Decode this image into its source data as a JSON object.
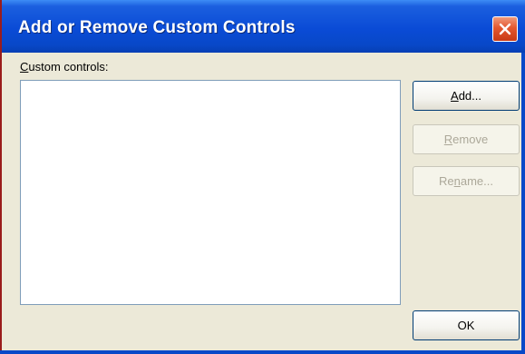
{
  "window": {
    "title": "Add or Remove Custom Controls"
  },
  "icons": {
    "close": "close-icon"
  },
  "colors": {
    "titlebar": "#0848c8",
    "dialog_bg": "#ece9d8",
    "close_button": "#e4572f",
    "disabled_text": "#aca899"
  },
  "label": {
    "mnemonic": "C",
    "rest": "ustom controls:"
  },
  "custom_controls_list": [],
  "buttons": {
    "add": {
      "mnemonic": "A",
      "rest": "dd...",
      "enabled": true
    },
    "remove": {
      "mnemonic": "R",
      "rest": "emove",
      "enabled": false
    },
    "rename": {
      "pre": "Re",
      "mnemonic": "n",
      "rest": "ame...",
      "enabled": false
    },
    "ok": {
      "label": "OK",
      "enabled": true
    }
  }
}
